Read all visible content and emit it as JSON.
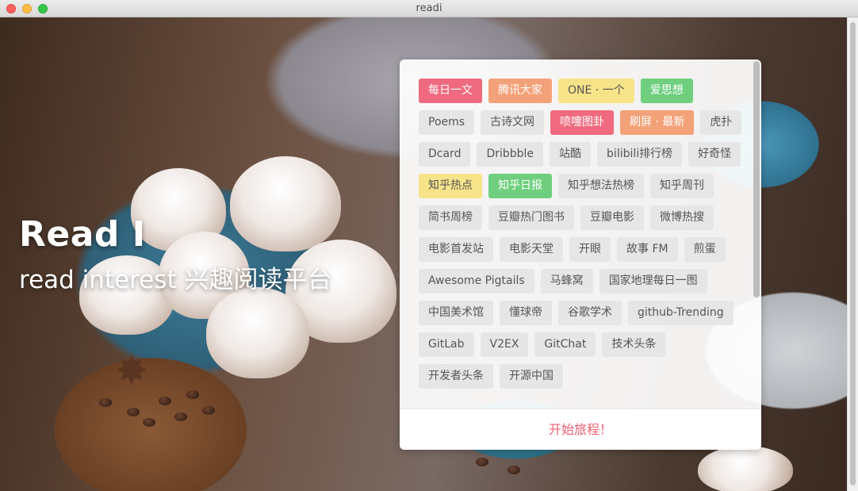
{
  "window": {
    "title": "readi"
  },
  "hero": {
    "title": "Read I",
    "subtitle": "read interest 兴趣阅读平台"
  },
  "colors": {
    "red": "#ef6a7e",
    "orange": "#f3a178",
    "yellow": "#f7e489",
    "green": "#6fcf7f",
    "accent": "#ef5f72"
  },
  "tags": [
    {
      "label": "每日一文",
      "color": "red"
    },
    {
      "label": "腾讯大家",
      "color": "orange"
    },
    {
      "label": "ONE · 一个",
      "color": "yellow"
    },
    {
      "label": "爱思想",
      "color": "green"
    },
    {
      "label": "Poems",
      "color": "gray"
    },
    {
      "label": "古诗文网",
      "color": "gray"
    },
    {
      "label": "喷嚏图卦",
      "color": "red"
    },
    {
      "label": "刷屏 · 最新",
      "color": "orange"
    },
    {
      "label": "虎扑",
      "color": "gray"
    },
    {
      "label": "Dcard",
      "color": "gray"
    },
    {
      "label": "Dribbble",
      "color": "gray"
    },
    {
      "label": "站酷",
      "color": "gray"
    },
    {
      "label": "bilibili排行榜",
      "color": "gray"
    },
    {
      "label": "好奇怪",
      "color": "gray"
    },
    {
      "label": "知乎热点",
      "color": "yellow"
    },
    {
      "label": "知乎日报",
      "color": "green"
    },
    {
      "label": "知乎想法热榜",
      "color": "gray"
    },
    {
      "label": "知乎周刊",
      "color": "gray"
    },
    {
      "label": "简书周榜",
      "color": "gray"
    },
    {
      "label": "豆瓣热门图书",
      "color": "gray"
    },
    {
      "label": "豆瓣电影",
      "color": "gray"
    },
    {
      "label": "微博热搜",
      "color": "gray"
    },
    {
      "label": "电影首发站",
      "color": "gray"
    },
    {
      "label": "电影天堂",
      "color": "gray"
    },
    {
      "label": "开眼",
      "color": "gray"
    },
    {
      "label": "故事 FM",
      "color": "gray"
    },
    {
      "label": "煎蛋",
      "color": "gray"
    },
    {
      "label": "Awesome Pigtails",
      "color": "gray"
    },
    {
      "label": "马蜂窝",
      "color": "gray"
    },
    {
      "label": "国家地理每日一图",
      "color": "gray"
    },
    {
      "label": "中国美术馆",
      "color": "gray"
    },
    {
      "label": "懂球帝",
      "color": "gray"
    },
    {
      "label": "谷歌学术",
      "color": "gray"
    },
    {
      "label": "github-Trending",
      "color": "gray"
    },
    {
      "label": "GitLab",
      "color": "gray"
    },
    {
      "label": "V2EX",
      "color": "gray"
    },
    {
      "label": "GitChat",
      "color": "gray"
    },
    {
      "label": "技术头条",
      "color": "gray"
    },
    {
      "label": "开发者头条",
      "color": "gray"
    },
    {
      "label": "开源中国",
      "color": "gray"
    }
  ],
  "footer": {
    "start_label": "开始旅程！"
  }
}
